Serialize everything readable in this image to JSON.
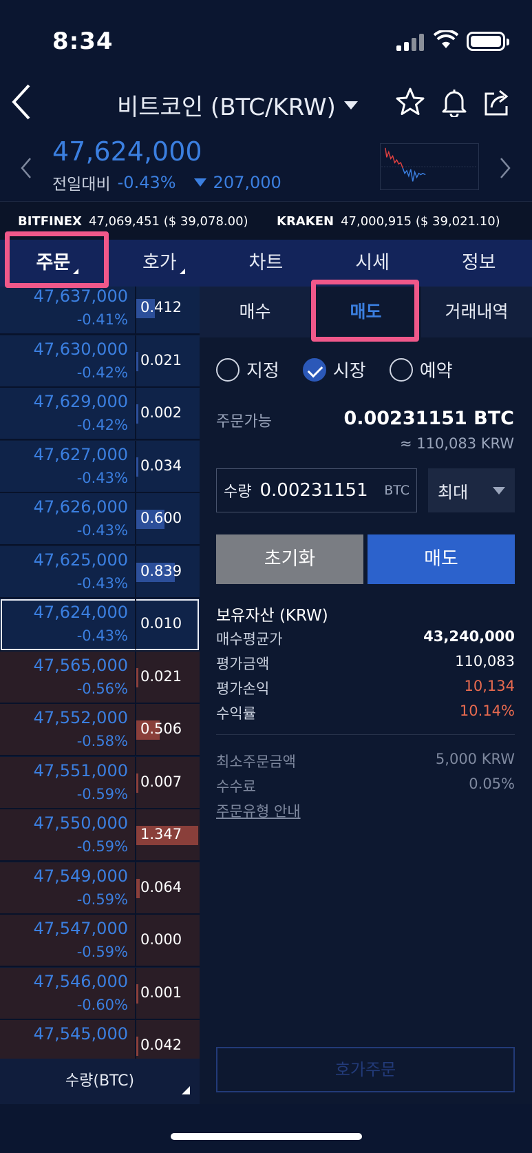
{
  "status_bar": {
    "time": "8:34"
  },
  "header": {
    "title": "비트코인 (BTC/KRW)"
  },
  "price": {
    "current": "47,624,000",
    "change_label": "전일대비",
    "change_pct": "-0.43%",
    "change_amt": "207,000"
  },
  "exchanges": [
    {
      "name": "BITFINEX",
      "value": "47,069,451 ($ 39,078.00)"
    },
    {
      "name": "KRAKEN",
      "value": "47,000,915 ($ 39,021.10)"
    }
  ],
  "tabs": [
    {
      "label": "주문"
    },
    {
      "label": "호가"
    },
    {
      "label": "차트"
    },
    {
      "label": "시세"
    },
    {
      "label": "정보"
    }
  ],
  "order_book": {
    "rows": [
      {
        "price": "47,637,000",
        "pct": "-0.41%",
        "qty": "0.412",
        "side": "ask",
        "fill": 0.3
      },
      {
        "price": "47,630,000",
        "pct": "-0.42%",
        "qty": "0.021",
        "side": "ask",
        "fill": 0.02
      },
      {
        "price": "47,629,000",
        "pct": "-0.42%",
        "qty": "0.002",
        "side": "ask",
        "fill": 0.01
      },
      {
        "price": "47,627,000",
        "pct": "-0.43%",
        "qty": "0.034",
        "side": "ask",
        "fill": 0.03
      },
      {
        "price": "47,626,000",
        "pct": "-0.43%",
        "qty": "0.600",
        "side": "ask",
        "fill": 0.45
      },
      {
        "price": "47,625,000",
        "pct": "-0.43%",
        "qty": "0.839",
        "side": "ask",
        "fill": 0.62
      },
      {
        "price": "47,624,000",
        "pct": "-0.43%",
        "qty": "0.010",
        "side": "ask",
        "fill": 0.0,
        "current": true
      },
      {
        "price": "47,565,000",
        "pct": "-0.56%",
        "qty": "0.021",
        "side": "bid",
        "fill": 0.02
      },
      {
        "price": "47,552,000",
        "pct": "-0.58%",
        "qty": "0.506",
        "side": "bid",
        "fill": 0.38
      },
      {
        "price": "47,551,000",
        "pct": "-0.59%",
        "qty": "0.007",
        "side": "bid",
        "fill": 0.01
      },
      {
        "price": "47,550,000",
        "pct": "-0.59%",
        "qty": "1.347",
        "side": "bid",
        "fill": 1.0
      },
      {
        "price": "47,549,000",
        "pct": "-0.59%",
        "qty": "0.064",
        "side": "bid",
        "fill": 0.05
      },
      {
        "price": "47,547,000",
        "pct": "-0.59%",
        "qty": "0.000",
        "side": "bid",
        "fill": 0.0
      },
      {
        "price": "47,546,000",
        "pct": "-0.60%",
        "qty": "0.001",
        "side": "bid",
        "fill": 0.01
      },
      {
        "price": "47,545,000",
        "pct": "",
        "qty": "0.042",
        "side": "bid",
        "fill": 0.03
      }
    ],
    "footer_label": "수량(BTC)"
  },
  "panel": {
    "subtabs": [
      {
        "label": "매수"
      },
      {
        "label": "매도"
      },
      {
        "label": "거래내역"
      }
    ],
    "order_types": [
      {
        "label": "지정"
      },
      {
        "label": "시장"
      },
      {
        "label": "예약"
      }
    ],
    "available_label": "주문가능",
    "available_btc": "0.00231151 BTC",
    "available_krw": "≈ 110,083 KRW",
    "qty_label": "수량",
    "qty_value": "0.00231151",
    "qty_unit": "BTC",
    "max_label": "최대",
    "reset_label": "초기화",
    "sell_label": "매도",
    "assets_title": "보유자산 (KRW)",
    "assets": [
      {
        "key": "매수평균가",
        "value": "43,240,000"
      },
      {
        "key": "평가금액",
        "value": "110,083"
      },
      {
        "key": "평가손익",
        "value": "10,134"
      },
      {
        "key": "수익률",
        "value": "10.14%"
      }
    ],
    "min_order_label": "최소주문금액",
    "min_order_value": "5,000 KRW",
    "fee_label": "수수료",
    "fee_value": "0.05%",
    "guide_label": "주문유형 안내",
    "order_button_label": "호가주문"
  },
  "colors": {
    "accent_blue": "#3b7fe0",
    "highlight_pink": "#f0588a",
    "profit_red": "#e86a4f"
  }
}
